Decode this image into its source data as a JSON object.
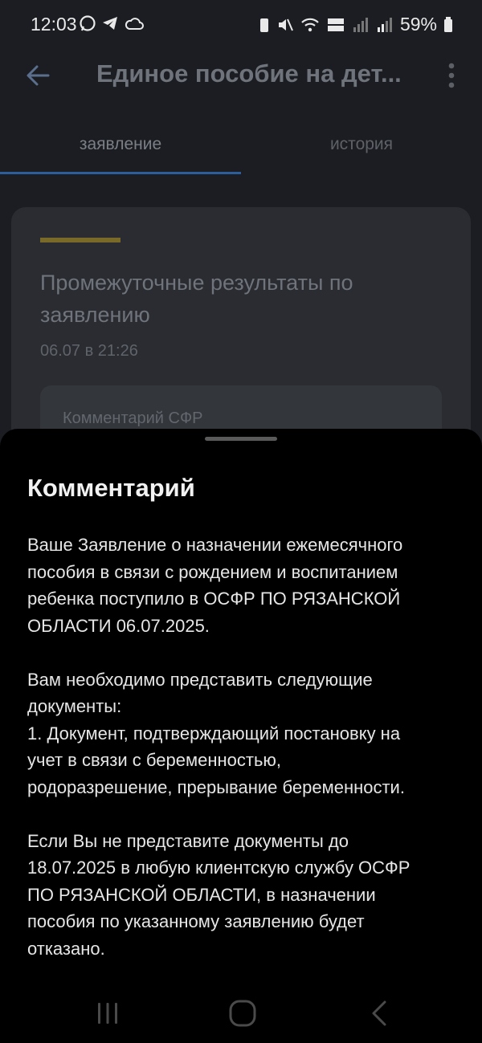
{
  "status_bar": {
    "time": "12:03",
    "battery": "59%"
  },
  "app_bar": {
    "title": "Единое пособие на дет...",
    "icons": [
      "back-arrow-icon",
      "more-vert-icon"
    ]
  },
  "tabs": [
    {
      "label": "заявление",
      "selected": true
    },
    {
      "label": "история",
      "selected": false
    }
  ],
  "card": {
    "title": "Промежуточные результаты по заявлению",
    "date": "06.07 в 21:26",
    "comment_label": "Комментарий СФР"
  },
  "sheet": {
    "title": "Комментарий",
    "paragraphs": [
      {
        "lines": [
          "Ваше Заявление о назначении ежемесячного",
          "пособия в связи с рождением и воспитанием",
          "ребенка поступило в ОСФР ПО РЯЗАНСКОЙ",
          "ОБЛАСТИ 06.07.2025."
        ]
      },
      {
        "lines": [
          "Вам необходимо представить следующие",
          "документы:",
          "1. Документ, подтверждающий постановку на",
          "учет в связи с беременностью,",
          "родоразрешение, прерывание беременности."
        ]
      },
      {
        "lines": [
          "Если Вы не представите документы до",
          "18.07.2025 в любую клиентскую службу ОСФР",
          "ПО РЯЗАНСКОЙ ОБЛАСТИ, в назначении",
          "пособия по указанному заявлению будет",
          "отказано."
        ]
      }
    ]
  },
  "colors": {
    "accent_line": "#7a6a29",
    "tab_indicator": "#2d5e9c",
    "sheet_background": "#000000"
  }
}
